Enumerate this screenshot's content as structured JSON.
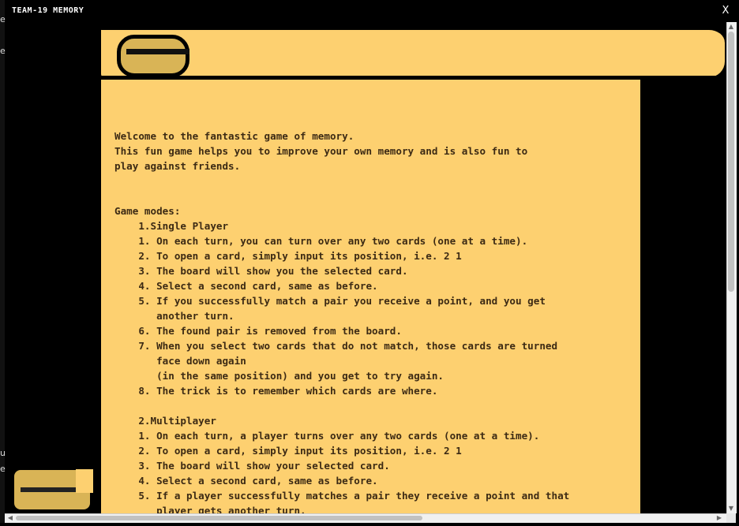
{
  "window": {
    "title": "TEAM-19 MEMORY",
    "close_label": "X"
  },
  "left_fragments": [
    "e",
    "e",
    "u",
    "e"
  ],
  "content": {
    "lines": [
      "Welcome to the fantastic game of memory.",
      "This fun game helps you to improve your own memory and is also fun to",
      "play against friends.",
      "",
      "",
      "Game modes:",
      "    1.Single Player",
      "    1. On each turn, you can turn over any two cards (one at a time).",
      "    2. To open a card, simply input its position, i.e. 2 1",
      "    3. The board will show you the selected card.",
      "    4. Select a second card, same as before.",
      "    5. If you successfully match a pair you receive a point, and you get",
      "       another turn.",
      "    6. The found pair is removed from the board.",
      "    7. When you select two cards that do not match, those cards are turned",
      "       face down again",
      "       (in the same position) and you get to try again.",
      "    8. The trick is to remember which cards are where.",
      "",
      "    2.Multiplayer",
      "    1. On each turn, a player turns over any two cards (one at a time).",
      "    2. To open a card, simply input its position, i.e. 2 1",
      "    3. The board will show your selected card.",
      "    4. Select a second card, same as before.",
      "    5. If a player successfully matches a pair they receive a point and that",
      "       player gets another turn."
    ]
  },
  "scrollbars": {
    "up_icon": "▲",
    "down_icon": "▼",
    "left_icon": "◀",
    "right_icon": "▶"
  },
  "colors": {
    "parchment": "#fdd070",
    "text": "#3c2a14",
    "background": "#000000"
  }
}
